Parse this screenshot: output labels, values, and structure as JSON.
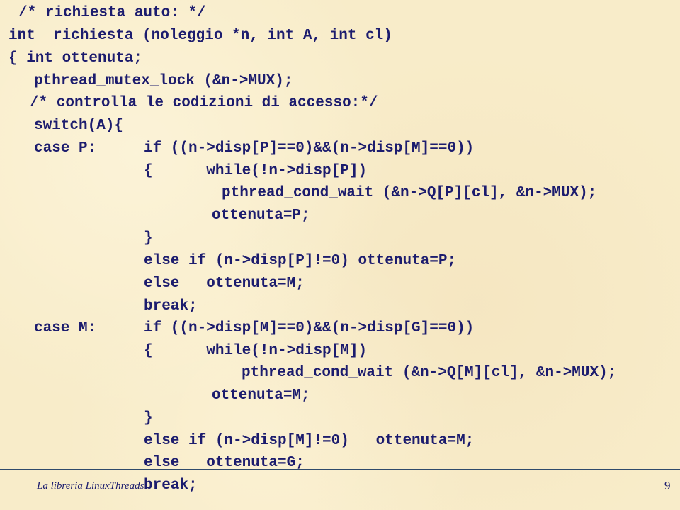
{
  "slide": {
    "code_lines": [
      "/* richiesta auto: */",
      "int  richiesta (noleggio *n, int A, int cl)",
      "{ int ottenuta;",
      "pthread_mutex_lock (&n->MUX);",
      "/* controlla le codizioni di accesso:*/",
      "switch(A){",
      "case P:",
      "if ((n->disp[P]==0)&&(n->disp[M]==0))",
      "{      while(!n->disp[P])",
      "pthread_cond_wait (&n->Q[P][cl], &n->MUX);",
      "ottenuta=P;",
      "}",
      "else if (n->disp[P]!=0) ottenuta=P;",
      "else   ottenuta=M;",
      "break;",
      "case M:",
      "if ((n->disp[M]==0)&&(n->disp[G]==0))",
      "{      while(!n->disp[M])",
      "pthread_cond_wait (&n->Q[M][cl], &n->MUX);",
      "ottenuta=M;",
      "}",
      "else if (n->disp[M]!=0)   ottenuta=M;",
      "else   ottenuta=G;",
      "break;"
    ],
    "footer": {
      "title": "La libreria LinuxThreads",
      "page_number": "9"
    }
  }
}
